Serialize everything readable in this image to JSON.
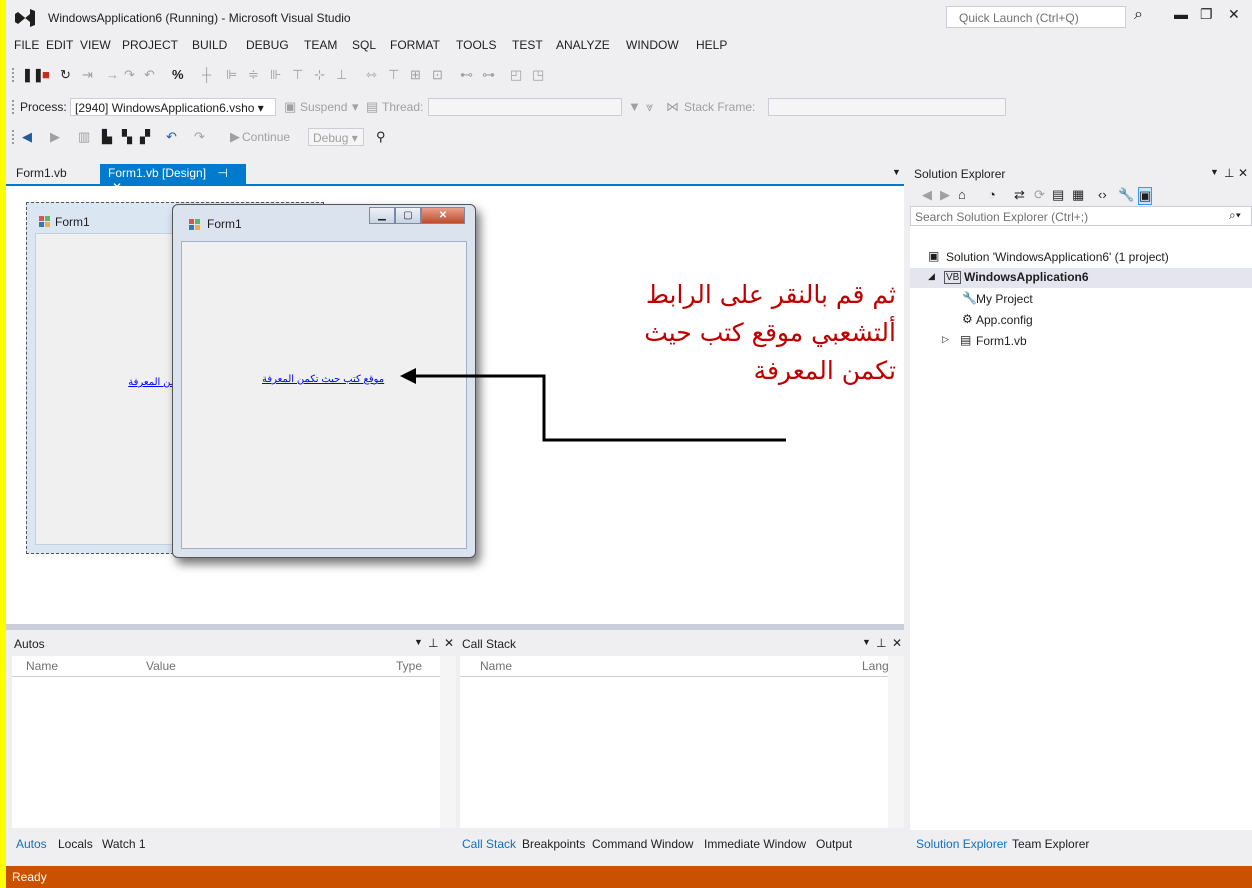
{
  "window": {
    "title": "WindowsApplication6 (Running) - Microsoft Visual Studio",
    "quick_launch_placeholder": "Quick Launch (Ctrl+Q)"
  },
  "menu": [
    "FILE",
    "EDIT",
    "VIEW",
    "PROJECT",
    "BUILD",
    "DEBUG",
    "TEAM",
    "SQL",
    "FORMAT",
    "TOOLS",
    "TEST",
    "ANALYZE",
    "WINDOW",
    "HELP"
  ],
  "debug_toolbar": {
    "process_label": "Process:",
    "process_value": "[2940] WindowsApplication6.vsho",
    "suspend_label": "Suspend",
    "thread_label": "Thread:",
    "stack_frame_label": "Stack Frame:",
    "continue_label": "Continue",
    "config_value": "Debug"
  },
  "tabs": [
    {
      "label": "Form1.vb",
      "active": false
    },
    {
      "label": "Form1.vb [Design]",
      "active": true
    }
  ],
  "designer": {
    "form_title": "Form1",
    "link_text_partial": "ث تكمن المعرفة",
    "running_form_title": "Form1",
    "link_text": "موقع كتب حيث تكمن المعرفة"
  },
  "annotation": {
    "text": "ثم قم بالنقر على الرابط ألتشعبي موقع كتب حيث تكمن المعرفة",
    "color": "#c00000"
  },
  "autos": {
    "title": "Autos",
    "columns": [
      "Name",
      "Value",
      "Type"
    ],
    "tabs": [
      "Autos",
      "Locals",
      "Watch 1"
    ]
  },
  "call_stack": {
    "title": "Call Stack",
    "columns": [
      "Name",
      "Lang"
    ],
    "tabs": [
      "Call Stack",
      "Breakpoints",
      "Command Window",
      "Immediate Window",
      "Output"
    ]
  },
  "solution_explorer": {
    "title": "Solution Explorer",
    "search_placeholder": "Search Solution Explorer (Ctrl+;)",
    "solution": "Solution 'WindowsApplication6' (1 project)",
    "project": "WindowsApplication6",
    "items": [
      "My Project",
      "App.config",
      "Form1.vb"
    ],
    "tabs": [
      "Solution Explorer",
      "Team Explorer"
    ]
  },
  "status": {
    "text": "Ready",
    "color": "#ca5100"
  }
}
